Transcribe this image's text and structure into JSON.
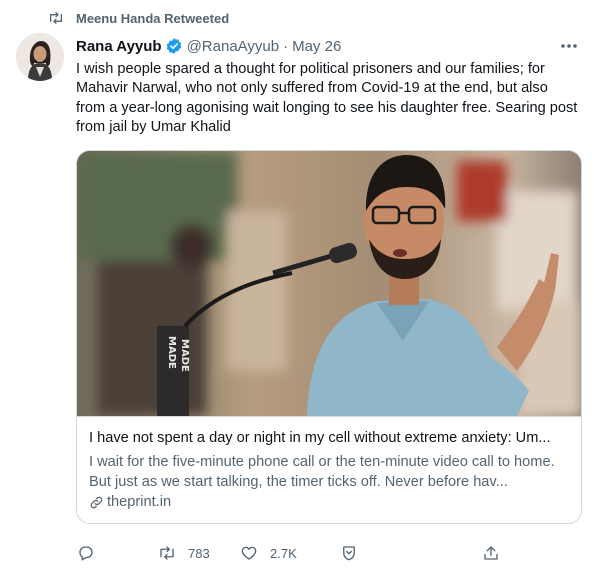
{
  "retweet": {
    "label": "Meenu Handa Retweeted",
    "icon": "retweet-icon"
  },
  "tweet": {
    "author_name": "Rana Ayyub",
    "verified": true,
    "handle": "@RanaAyyub",
    "separator": "·",
    "date": "May 26",
    "text": "I wish people spared a thought for political prisoners and our families; for Mahavir Narwal, who not only suffered from Covid-19 at the end, but also from a year-long agonising wait longing to see his daughter free. Searing post from jail by Umar Khalid"
  },
  "card": {
    "title": "I have not spent a day or night in my cell without extreme anxiety: Um...",
    "description": "I wait for the five-minute phone call or the ten-minute video call to home. But just as we start talking, the timer ticks off. Never before hav...",
    "domain": "theprint.in",
    "image_banner_text": "MADE",
    "image_banner_text_2": "MADE"
  },
  "actions": {
    "reply_count": "",
    "retweet_count": "783",
    "like_count": "2.7K",
    "share_label": ""
  },
  "colors": {
    "accent": "#1d9bf0",
    "muted": "#536471",
    "border": "#cfd9de"
  }
}
